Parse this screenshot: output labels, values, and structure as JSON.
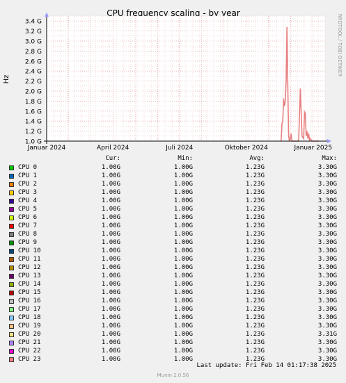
{
  "chart_data": {
    "type": "line",
    "title": "CPU frequency scaling - by year",
    "ylabel": "Hz",
    "watermark": "RRDTOOL / TOBI OETIKER",
    "y_ticks": [
      "1.0 G",
      "1.2 G",
      "1.4 G",
      "1.6 G",
      "1.8 G",
      "2.0 G",
      "2.2 G",
      "2.4 G",
      "2.6 G",
      "2.8 G",
      "3.0 G",
      "3.2 G",
      "3.4 G"
    ],
    "ylim": [
      1.0,
      3.5
    ],
    "x_ticks": [
      "Januar 2024",
      "April 2024",
      "Juli 2024",
      "Oktober 2024",
      "Januar 2025"
    ],
    "grid": true,
    "series_color": "#e88080",
    "series": [
      {
        "name": "CPU 0",
        "x": [
          0.842,
          0.845,
          0.848,
          0.851,
          0.854,
          0.857,
          0.86,
          0.863,
          0.866,
          0.869,
          0.872,
          0.875,
          0.878,
          0.881,
          0.884,
          0.887,
          0.893,
          0.899,
          0.905,
          0.911,
          0.917,
          0.923,
          0.926,
          0.929,
          0.932,
          0.935,
          0.938,
          0.941,
          0.944,
          0.947,
          0.953,
          0.958,
          0.962,
          0.967,
          0.972,
          0.978
        ],
        "y": [
          1.0,
          1.35,
          1.4,
          1.85,
          1.7,
          1.8,
          2.2,
          3.28,
          2.1,
          1.1,
          1.0,
          1.05,
          1.15,
          1.0,
          1.0,
          1.0,
          1.0,
          1.0,
          1.0,
          2.05,
          1.1,
          1.05,
          1.58,
          1.55,
          1.1,
          1.2,
          1.05,
          1.15,
          1.02,
          1.05,
          1.0,
          1.0,
          1.0,
          1.0,
          1.0,
          1.0
        ]
      }
    ]
  },
  "legend": {
    "headers": {
      "cur": "Cur:",
      "min": "Min:",
      "avg": "Avg:",
      "max": "Max:"
    },
    "rows": [
      {
        "name": "CPU 0",
        "color": "#00cc00",
        "cur": "1.00G",
        "min": "1.00G",
        "avg": "1.23G",
        "max": "3.30G"
      },
      {
        "name": "CPU 1",
        "color": "#0066b3",
        "cur": "1.00G",
        "min": "1.00G",
        "avg": "1.23G",
        "max": "3.30G"
      },
      {
        "name": "CPU 2",
        "color": "#ff8000",
        "cur": "1.00G",
        "min": "1.00G",
        "avg": "1.23G",
        "max": "3.30G"
      },
      {
        "name": "CPU 3",
        "color": "#ffcc00",
        "cur": "1.00G",
        "min": "1.00G",
        "avg": "1.23G",
        "max": "3.30G"
      },
      {
        "name": "CPU 4",
        "color": "#330099",
        "cur": "1.00G",
        "min": "1.00G",
        "avg": "1.23G",
        "max": "3.30G"
      },
      {
        "name": "CPU 5",
        "color": "#990099",
        "cur": "1.00G",
        "min": "1.00G",
        "avg": "1.23G",
        "max": "3.30G"
      },
      {
        "name": "CPU 6",
        "color": "#ccff00",
        "cur": "1.00G",
        "min": "1.00G",
        "avg": "1.23G",
        "max": "3.30G"
      },
      {
        "name": "CPU 7",
        "color": "#ff0000",
        "cur": "1.00G",
        "min": "1.00G",
        "avg": "1.23G",
        "max": "3.30G"
      },
      {
        "name": "CPU 8",
        "color": "#808080",
        "cur": "1.00G",
        "min": "1.00G",
        "avg": "1.23G",
        "max": "3.30G"
      },
      {
        "name": "CPU 9",
        "color": "#008f00",
        "cur": "1.00G",
        "min": "1.00G",
        "avg": "1.23G",
        "max": "3.30G"
      },
      {
        "name": "CPU 10",
        "color": "#00487d",
        "cur": "1.00G",
        "min": "1.00G",
        "avg": "1.23G",
        "max": "3.30G"
      },
      {
        "name": "CPU 11",
        "color": "#b35a00",
        "cur": "1.00G",
        "min": "1.00G",
        "avg": "1.23G",
        "max": "3.30G"
      },
      {
        "name": "CPU 12",
        "color": "#b38f00",
        "cur": "1.00G",
        "min": "1.00G",
        "avg": "1.23G",
        "max": "3.30G"
      },
      {
        "name": "CPU 13",
        "color": "#6b006b",
        "cur": "1.00G",
        "min": "1.00G",
        "avg": "1.23G",
        "max": "3.30G"
      },
      {
        "name": "CPU 14",
        "color": "#8fb300",
        "cur": "1.00G",
        "min": "1.00G",
        "avg": "1.23G",
        "max": "3.30G"
      },
      {
        "name": "CPU 15",
        "color": "#b30000",
        "cur": "1.00G",
        "min": "1.00G",
        "avg": "1.23G",
        "max": "3.30G"
      },
      {
        "name": "CPU 16",
        "color": "#bebebe",
        "cur": "1.00G",
        "min": "1.00G",
        "avg": "1.23G",
        "max": "3.30G"
      },
      {
        "name": "CPU 17",
        "color": "#80ff80",
        "cur": "1.00G",
        "min": "1.00G",
        "avg": "1.23G",
        "max": "3.30G"
      },
      {
        "name": "CPU 18",
        "color": "#80c9ff",
        "cur": "1.00G",
        "min": "1.00G",
        "avg": "1.23G",
        "max": "3.30G"
      },
      {
        "name": "CPU 19",
        "color": "#ffc080",
        "cur": "1.00G",
        "min": "1.00G",
        "avg": "1.23G",
        "max": "3.30G"
      },
      {
        "name": "CPU 20",
        "color": "#ffe680",
        "cur": "1.00G",
        "min": "1.00G",
        "avg": "1.23G",
        "max": "3.31G"
      },
      {
        "name": "CPU 21",
        "color": "#aa80ff",
        "cur": "1.00G",
        "min": "1.00G",
        "avg": "1.23G",
        "max": "3.30G"
      },
      {
        "name": "CPU 22",
        "color": "#ee00cc",
        "cur": "1.00G",
        "min": "1.00G",
        "avg": "1.23G",
        "max": "3.30G"
      },
      {
        "name": "CPU 23",
        "color": "#ff8080",
        "cur": "1.00G",
        "min": "1.00G",
        "avg": "1.23G",
        "max": "3.30G"
      }
    ]
  },
  "footer": {
    "last_update": "Last update: Fri Feb 14 01:17:38 2025",
    "version": "Munin 2.0.56"
  }
}
